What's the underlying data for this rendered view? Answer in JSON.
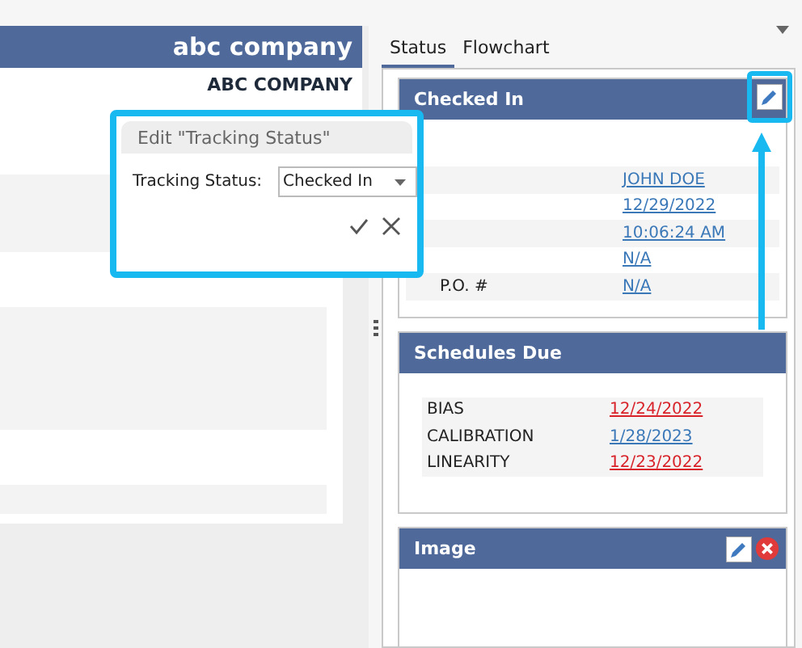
{
  "company_bar": {
    "title": "abc company"
  },
  "company_name": "ABC COMPANY",
  "tabs": [
    {
      "label": "Status",
      "selected": true
    },
    {
      "label": "Flowchart",
      "selected": false
    }
  ],
  "status_panel": {
    "title": "Checked In",
    "highlighted": true,
    "rows": [
      {
        "value": "JOHN DOE"
      },
      {
        "value": "12/29/2022"
      },
      {
        "value": "10:06:24 AM"
      },
      {
        "value": "N/A"
      },
      {
        "label": "P.O. #",
        "value": "N/A"
      }
    ]
  },
  "schedules_panel": {
    "title": "Schedules Due",
    "rows": [
      {
        "label": "BIAS",
        "value": "12/24/2022",
        "overdue": true
      },
      {
        "label": "CALIBRATION",
        "value": "1/28/2023",
        "overdue": false
      },
      {
        "label": "LINEARITY",
        "value": "12/23/2022",
        "overdue": true
      }
    ]
  },
  "image_panel": {
    "title": "Image"
  },
  "edit_dialog": {
    "title": "Edit \"Tracking Status\"",
    "field_label": "Tracking Status:",
    "value": "Checked In"
  }
}
